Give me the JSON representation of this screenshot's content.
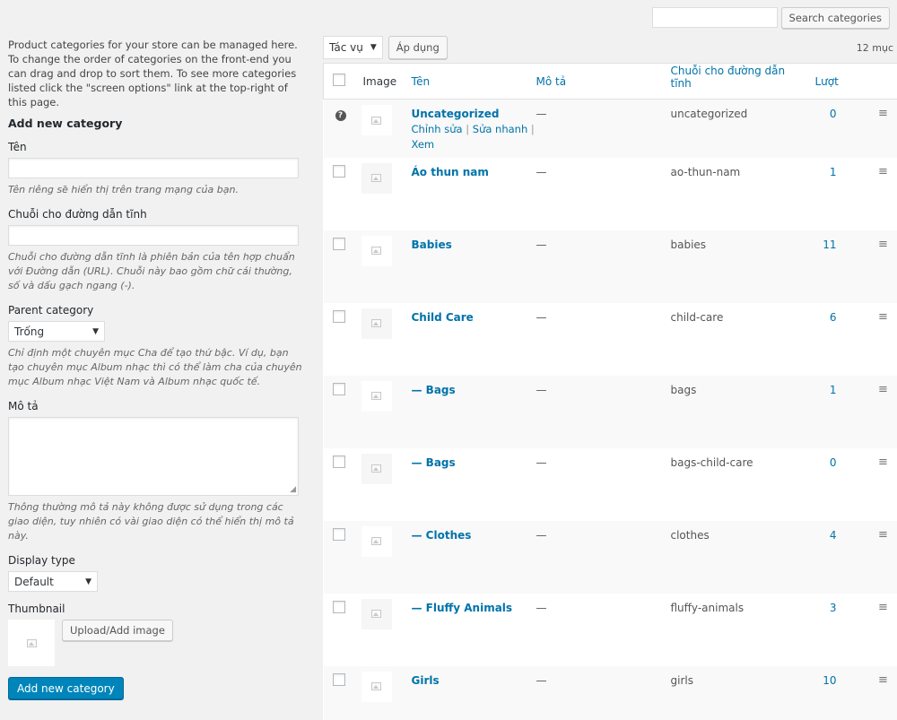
{
  "search": {
    "placeholder": "",
    "button": "Search categories"
  },
  "intro": "Product categories for your store can be managed here. To change the order of categories on the front-end you can drag and drop to sort them. To see more categories listed click the \"screen options\" link at the top-right of this page.",
  "form": {
    "title": "Add new category",
    "name_label": "Tên",
    "name_desc": "Tên riêng sẽ hiển thị trên trang mạng của bạn.",
    "slug_label": "Chuỗi cho đường dẫn tĩnh",
    "slug_desc": "Chuỗi cho đường dẫn tĩnh là phiên bản của tên hợp chuẩn với Đường dẫn (URL). Chuỗi này bao gồm chữ cái thường, số và dấu gạch ngang (-).",
    "parent_label": "Parent category",
    "parent_value": "Trống",
    "parent_desc": "Chỉ định một chuyên mục Cha để tạo thứ bậc. Ví dụ, bạn tạo chuyên mục Album nhạc thì có thể làm cha của chuyên mục Album nhạc Việt Nam và Album nhạc quốc tế.",
    "desc_label": "Mô tả",
    "desc_desc": "Thông thường mô tả này không được sử dụng trong các giao diện, tuy nhiên có vài giao diện có thể hiển thị mô tả này.",
    "display_label": "Display type",
    "display_value": "Default",
    "thumbnail_label": "Thumbnail",
    "upload_button": "Upload/Add image",
    "submit_button": "Add new category"
  },
  "bulk": {
    "action": "Tác vụ",
    "apply": "Áp dụng",
    "count": "12 mục"
  },
  "columns": {
    "image": "Image",
    "name": "Tên",
    "description": "Mô tả",
    "slug": "Chuỗi cho đường dẫn tĩnh",
    "count": "Lượt"
  },
  "rows": [
    {
      "name": "Uncategorized",
      "desc": "—",
      "slug": "uncategorized",
      "count": "0",
      "actions": {
        "edit": "Chỉnh sửa",
        "quick": "Sửa nhanh",
        "view": "Xem"
      }
    },
    {
      "name": "Áo thun nam",
      "desc": "—",
      "slug": "ao-thun-nam",
      "count": "1"
    },
    {
      "name": "Babies",
      "desc": "—",
      "slug": "babies",
      "count": "11"
    },
    {
      "name": "Child Care",
      "desc": "—",
      "slug": "child-care",
      "count": "6"
    },
    {
      "name": "— Bags",
      "desc": "—",
      "slug": "bags",
      "count": "1"
    },
    {
      "name": "— Bags",
      "desc": "—",
      "slug": "bags-child-care",
      "count": "0"
    },
    {
      "name": "— Clothes",
      "desc": "—",
      "slug": "clothes",
      "count": "4"
    },
    {
      "name": "— Fluffy Animals",
      "desc": "—",
      "slug": "fluffy-animals",
      "count": "3"
    },
    {
      "name": "Girls",
      "desc": "—",
      "slug": "girls",
      "count": "10"
    }
  ]
}
